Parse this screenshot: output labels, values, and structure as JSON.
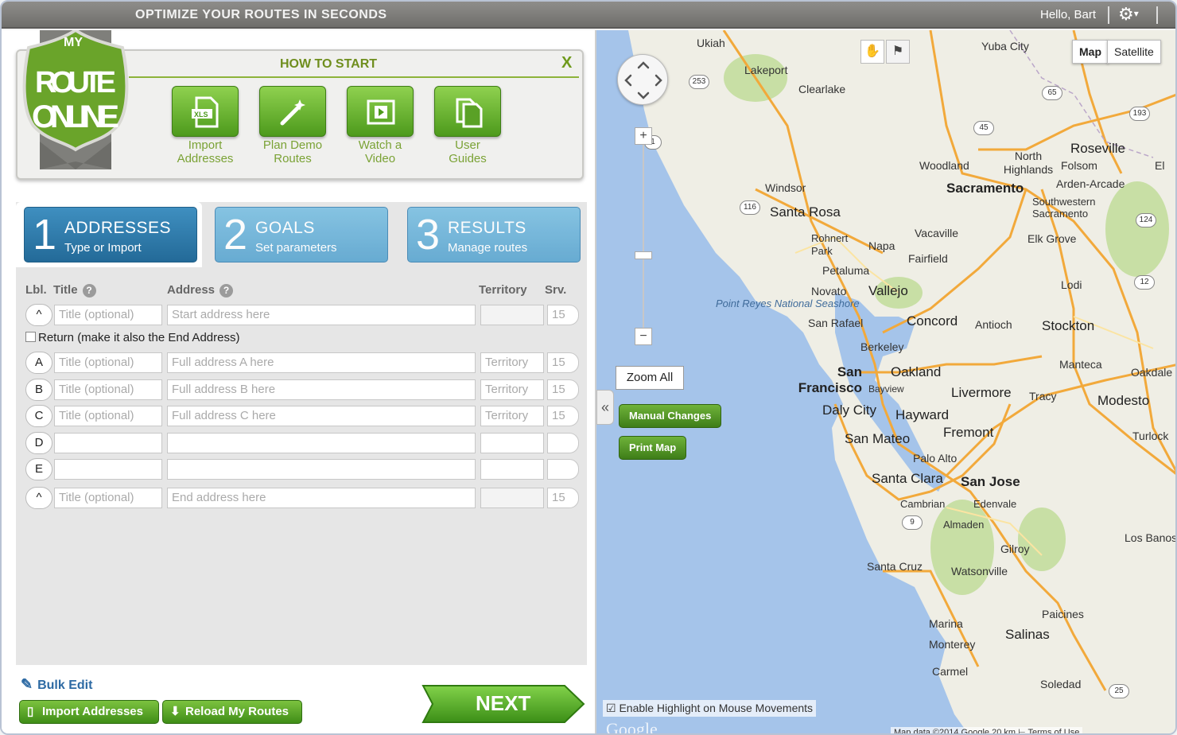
{
  "topbar": {
    "tagline": "OPTIMIZE YOUR ROUTES IN SECONDS",
    "greeting": "Hello, Bart"
  },
  "logo": {
    "line1": "MY",
    "line2": "ROUTE",
    "line3": "ONLINE"
  },
  "howto": {
    "title": "HOW TO START",
    "close": "X",
    "buttons": [
      {
        "label_line1": "Import",
        "label_line2": "Addresses",
        "icon": "xls-file-icon"
      },
      {
        "label_line1": "Plan Demo",
        "label_line2": "Routes",
        "icon": "magic-wand-icon"
      },
      {
        "label_line1": "Watch a",
        "label_line2": "Video",
        "icon": "film-icon"
      },
      {
        "label_line1": "User",
        "label_line2": "Guides",
        "icon": "documents-icon"
      }
    ]
  },
  "tabs": [
    {
      "num": "1",
      "title": "ADDRESSES",
      "sub": "Type or Import"
    },
    {
      "num": "2",
      "title": "GOALS",
      "sub": "Set parameters"
    },
    {
      "num": "3",
      "title": "RESULTS",
      "sub": "Manage routes"
    }
  ],
  "table": {
    "headers": {
      "lbl": "Lbl.",
      "title": "Title",
      "address": "Address",
      "territory": "Territory",
      "srv": "Srv."
    },
    "help_glyph": "?",
    "start_row": {
      "label": "^",
      "title": "Title (optional)",
      "address": "Start address here",
      "territory": "",
      "srv": "15"
    },
    "return_text": "Return (make it also the End Address)",
    "rows": [
      {
        "label": "A",
        "title": "Title (optional)",
        "address": "Full address A here",
        "territory": "Territory",
        "srv": "15"
      },
      {
        "label": "B",
        "title": "Title (optional)",
        "address": "Full address B here",
        "territory": "Territory",
        "srv": "15"
      },
      {
        "label": "C",
        "title": "Title (optional)",
        "address": "Full address C here",
        "territory": "Territory",
        "srv": "15"
      },
      {
        "label": "D",
        "title": "",
        "address": "",
        "territory": "",
        "srv": ""
      },
      {
        "label": "E",
        "title": "",
        "address": "",
        "territory": "",
        "srv": ""
      }
    ],
    "end_row": {
      "label": "^",
      "title": "Title (optional)",
      "address": "End address here",
      "territory": "",
      "srv": "15"
    }
  },
  "bottom": {
    "bulk_edit": "Bulk Edit",
    "import_addresses": "Import Addresses",
    "reload_routes": "Reload My Routes",
    "next": "NEXT"
  },
  "map": {
    "type_map": "Map",
    "type_satellite": "Satellite",
    "zoom_all": "Zoom All",
    "manual_changes": "Manual Changes",
    "print_map": "Print Map",
    "collapse": "«",
    "highlight_label": "Enable Highlight on Mouse Movements",
    "google": "Google",
    "map_data": "Map data ©2014 Google   20 km ⊢   Terms of Use",
    "colors": {
      "water": "#a5c4ea",
      "land": "#efeee5",
      "highway": "#f2a93b",
      "park": "#c8dfa5"
    },
    "places": [
      {
        "name": "Ukiah"
      },
      {
        "name": "Yuba City"
      },
      {
        "name": "Lakeport"
      },
      {
        "name": "Clearlake"
      },
      {
        "name": "Roseville"
      },
      {
        "name": "North Highlands"
      },
      {
        "name": "Woodland"
      },
      {
        "name": "Folsom"
      },
      {
        "name": "Sacramento"
      },
      {
        "name": "Arden-Arcade"
      },
      {
        "name": "Windsor"
      },
      {
        "name": "Santa Rosa"
      },
      {
        "name": "Southwestern Sacramento"
      },
      {
        "name": "Vacaville"
      },
      {
        "name": "Rohnert Park"
      },
      {
        "name": "Napa"
      },
      {
        "name": "Elk Grove"
      },
      {
        "name": "Fairfield"
      },
      {
        "name": "Petaluma"
      },
      {
        "name": "Lodi"
      },
      {
        "name": "Novato"
      },
      {
        "name": "Vallejo"
      },
      {
        "name": "Point Reyes National Seashore"
      },
      {
        "name": "San Rafael"
      },
      {
        "name": "Concord"
      },
      {
        "name": "Antioch"
      },
      {
        "name": "Stockton"
      },
      {
        "name": "Berkeley"
      },
      {
        "name": "San Francisco"
      },
      {
        "name": "Oakland"
      },
      {
        "name": "Manteca"
      },
      {
        "name": "Oakdale"
      },
      {
        "name": "Bayview"
      },
      {
        "name": "Livermore"
      },
      {
        "name": "Tracy"
      },
      {
        "name": "Modesto"
      },
      {
        "name": "Daly City"
      },
      {
        "name": "Hayward"
      },
      {
        "name": "San Mateo"
      },
      {
        "name": "Fremont"
      },
      {
        "name": "Turlock"
      },
      {
        "name": "Palo Alto"
      },
      {
        "name": "Santa Clara"
      },
      {
        "name": "San Jose"
      },
      {
        "name": "Cambrian"
      },
      {
        "name": "Edenvale"
      },
      {
        "name": "Almaden"
      },
      {
        "name": "Los Banos"
      },
      {
        "name": "Gilroy"
      },
      {
        "name": "Santa Cruz"
      },
      {
        "name": "Watsonville"
      },
      {
        "name": "Paicines"
      },
      {
        "name": "Marina"
      },
      {
        "name": "Salinas"
      },
      {
        "name": "Monterey"
      },
      {
        "name": "Carmel"
      },
      {
        "name": "Soledad"
      },
      {
        "name": "El"
      }
    ],
    "shields": [
      "253",
      "65",
      "193",
      "45",
      "116",
      "124",
      "12",
      "9",
      "25",
      "1"
    ]
  }
}
